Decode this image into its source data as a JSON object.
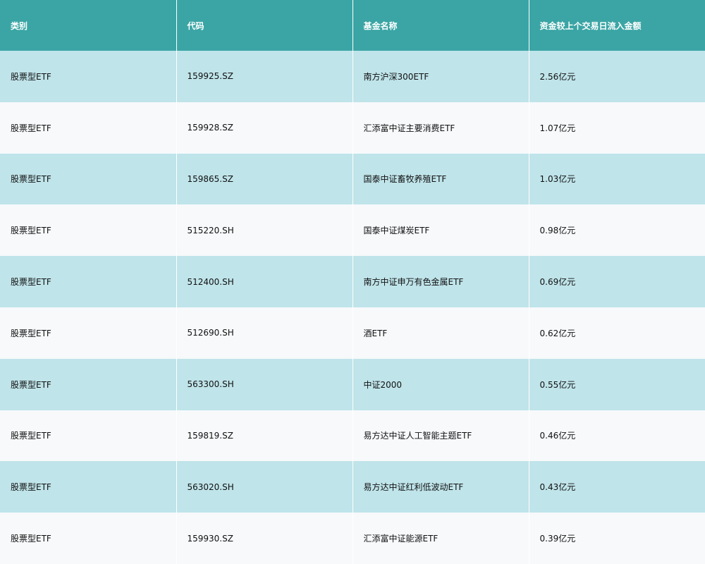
{
  "table": {
    "headers": [
      "类别",
      "代码",
      "基金名称",
      "资金较上个交易日流入金额"
    ],
    "rows": [
      [
        "股票型ETF",
        "159925.SZ",
        "南方沪深300ETF",
        "2.56亿元"
      ],
      [
        "股票型ETF",
        "159928.SZ",
        "汇添富中证主要消费ETF",
        "1.07亿元"
      ],
      [
        "股票型ETF",
        "159865.SZ",
        "国泰中证畜牧养殖ETF",
        "1.03亿元"
      ],
      [
        "股票型ETF",
        "515220.SH",
        "国泰中证煤炭ETF",
        "0.98亿元"
      ],
      [
        "股票型ETF",
        "512400.SH",
        "南方中证申万有色金属ETF",
        "0.69亿元"
      ],
      [
        "股票型ETF",
        "512690.SH",
        "酒ETF",
        "0.62亿元"
      ],
      [
        "股票型ETF",
        "563300.SH",
        "中证2000",
        "0.55亿元"
      ],
      [
        "股票型ETF",
        "159819.SZ",
        "易方达中证人工智能主题ETF",
        "0.46亿元"
      ],
      [
        "股票型ETF",
        "563020.SH",
        "易方达中证红利低波动ETF",
        "0.43亿元"
      ],
      [
        "股票型ETF",
        "159930.SZ",
        "汇添富中证能源ETF",
        "0.39亿元"
      ]
    ]
  },
  "colors": {
    "header_bg": "#3ba5a5",
    "row_odd_bg": "#bfe4ea",
    "row_even_bg": "#f7f9fb"
  }
}
